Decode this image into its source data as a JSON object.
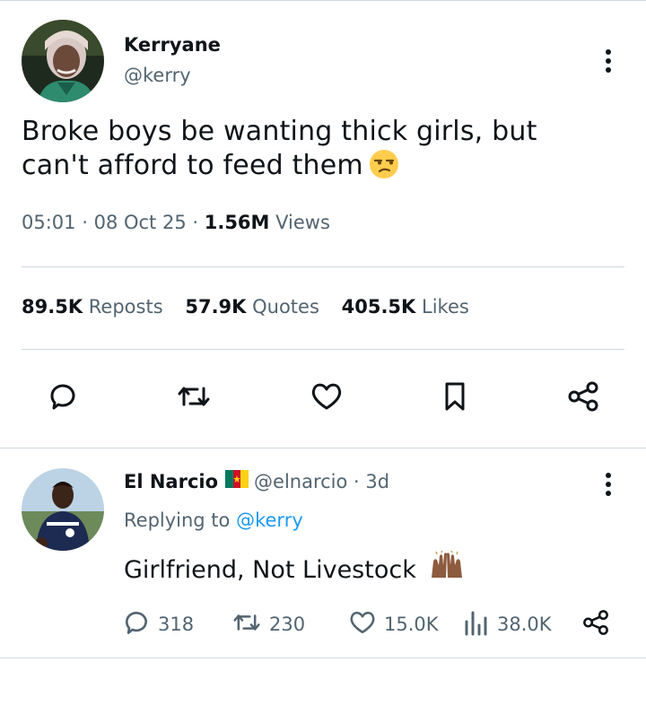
{
  "tweet": {
    "author_name": "Kerryane",
    "author_handle": "@kerry",
    "text": "Broke boys be wanting thick girls, but can't afford to feed them",
    "emoji": "unamused-face",
    "time": "05:01",
    "date": "08 Oct 25",
    "views_count": "1.56M",
    "views_label": "Views",
    "stats": [
      {
        "count": "89.5K",
        "label": "Reposts"
      },
      {
        "count": "57.9K",
        "label": "Quotes"
      },
      {
        "count": "405.5K",
        "label": "Likes"
      }
    ],
    "actions": [
      "reply-icon",
      "repost-icon",
      "like-icon",
      "bookmark-icon",
      "share-icon"
    ]
  },
  "reply": {
    "author_name": "El Narcio",
    "flag": "cameroon-flag",
    "author_handle": "@elnarcio",
    "age": "3d",
    "replying_prefix": "Replying to",
    "replying_handle": "@kerry",
    "text": "Girlfriend, Not Livestock",
    "emoji": "raising-hands-medium-dark",
    "reply_count": "318",
    "repost_count": "230",
    "like_count": "15.0K",
    "view_count": "38.0K"
  },
  "colors": {
    "text": "#0f1419",
    "secondary": "#536471",
    "link": "#1d9bf0",
    "divider": "#cfd9de"
  }
}
